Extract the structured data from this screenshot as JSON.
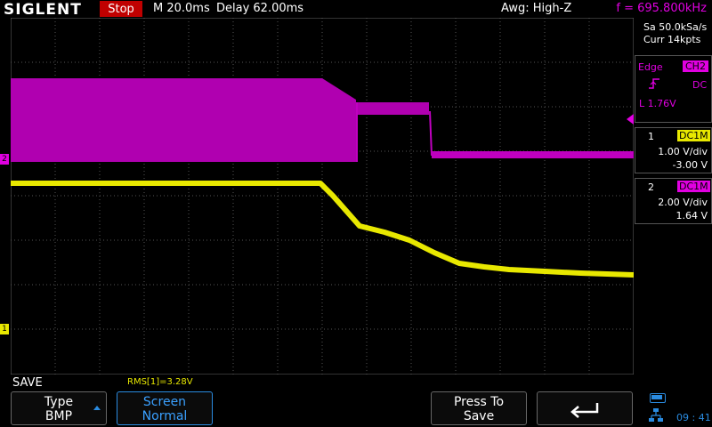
{
  "header": {
    "brand": "SIGLENT",
    "run_state": "Stop",
    "timebase": "M 20.0ms",
    "delay": "Delay 62.00ms",
    "awg": "Awg: High-Z",
    "frequency": "f = 695.800kHz"
  },
  "acquisition": {
    "sample_rate": "Sa 50.0kSa/s",
    "memory": "Curr 14kpts"
  },
  "trigger": {
    "type": "Edge",
    "source": "CH2",
    "coupling": "DC",
    "level": "L  1.76V"
  },
  "channels": [
    {
      "number": "1",
      "coupling": "DC1M",
      "scale": "1.00 V/div",
      "offset": "-3.00 V",
      "color": "#e8e800"
    },
    {
      "number": "2",
      "coupling": "DC1M",
      "scale": "2.00 V/div",
      "offset": "1.64 V",
      "color": "#e000e0"
    }
  ],
  "markers": {
    "ch1": "1",
    "ch2": "2"
  },
  "bottom": {
    "menu_title": "SAVE",
    "measurement": "RMS[1]=3.28V",
    "buttons": [
      {
        "title": "Type",
        "value": "BMP"
      },
      {
        "title": "Screen",
        "value": "Normal"
      },
      {
        "title": "Press To",
        "value": "Save"
      },
      {
        "title": "back-icon",
        "value": ""
      }
    ],
    "clock": "09 : 41"
  },
  "icons": [
    "trigger-position-icon",
    "rising-edge-icon",
    "battery-icon",
    "network-icon",
    "back-arrow-icon"
  ]
}
